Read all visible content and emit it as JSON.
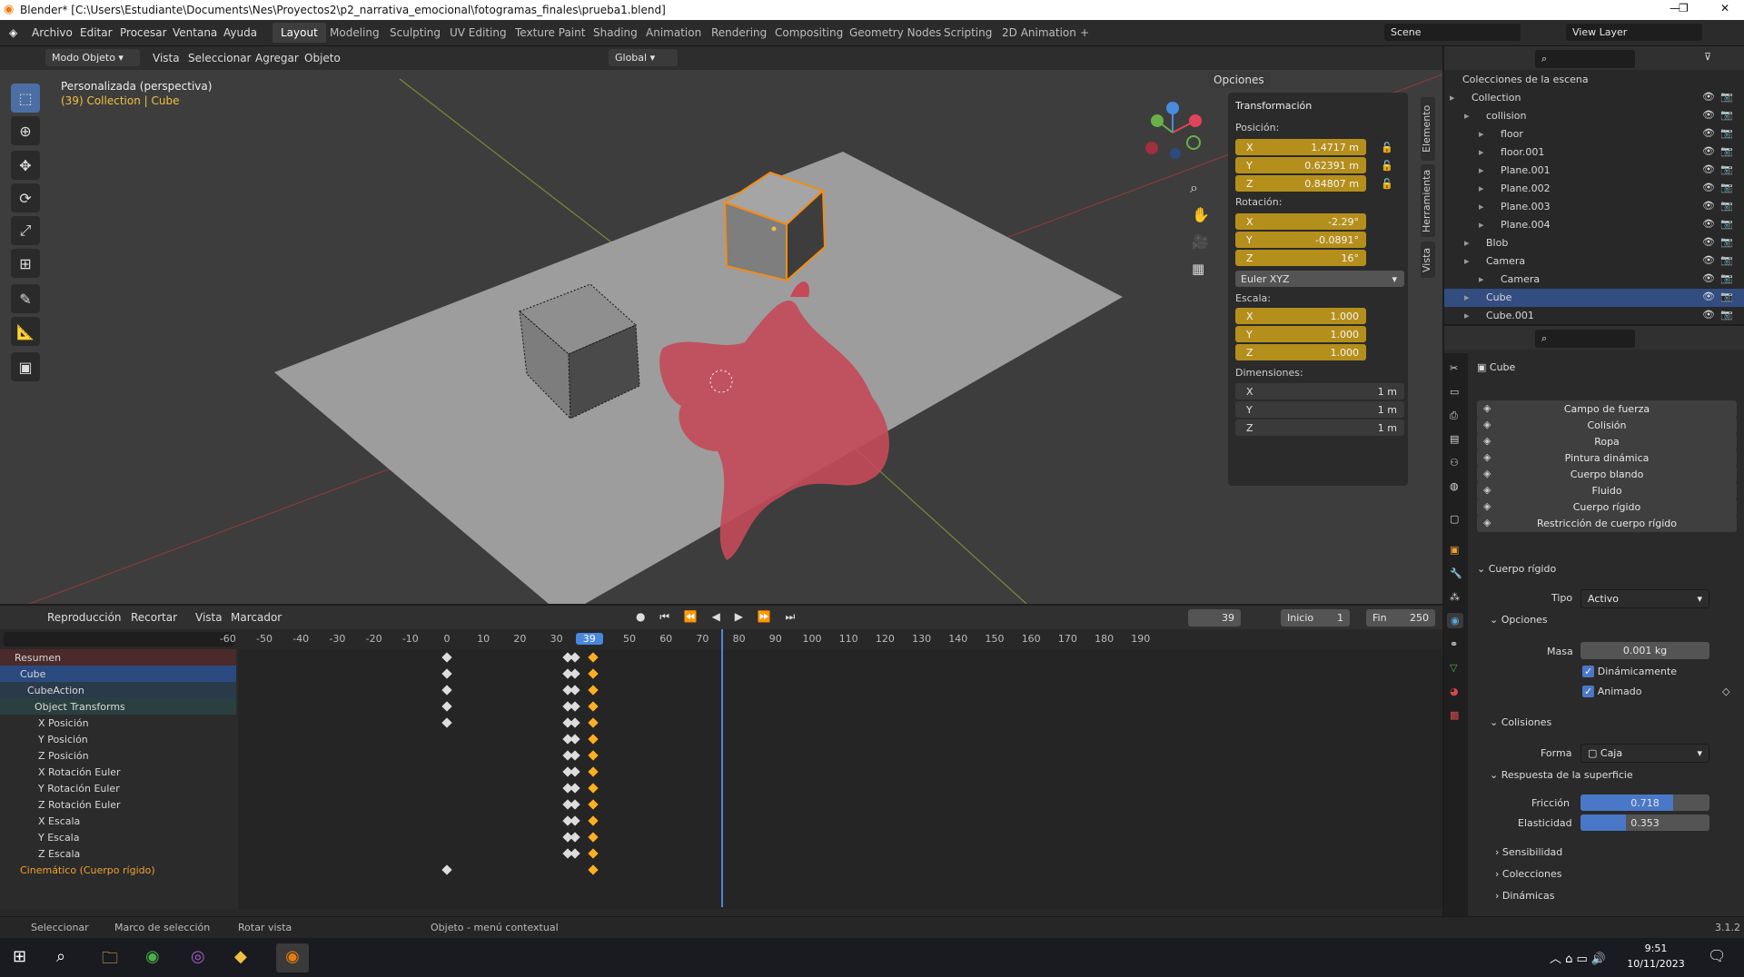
{
  "window": {
    "title": "Blender* [C:\\Users\\Estudiante\\Documents\\Nes\\Proyectos2\\p2_narrativa_emocional\\fotogramas_finales\\prueba1.blend]"
  },
  "menu": [
    "Archivo",
    "Editar",
    "Procesar",
    "Ventana",
    "Ayuda"
  ],
  "workspaces": [
    "Layout",
    "Modeling",
    "Sculpting",
    "UV Editing",
    "Texture Paint",
    "Shading",
    "Animation",
    "Rendering",
    "Compositing",
    "Geometry Nodes",
    "Scripting",
    "2D Animation",
    "+"
  ],
  "scene": "Scene",
  "view_layer": "View Layer",
  "viewport": {
    "mode": "Modo Objeto",
    "menu": [
      "Vista",
      "Seleccionar",
      "Agregar",
      "Objeto"
    ],
    "orientation": "Global",
    "options": "Opciones",
    "view_name": "Personalizada (perspectiva)",
    "collection_info": "(39) Collection | Cube"
  },
  "transform": {
    "header": "Transformación",
    "position_label": "Posición:",
    "position": [
      {
        "axis": "X",
        "value": "1.4717 m"
      },
      {
        "axis": "Y",
        "value": "0.62391 m"
      },
      {
        "axis": "Z",
        "value": "0.84807 m"
      }
    ],
    "rotation_label": "Rotación:",
    "rotation": [
      {
        "axis": "X",
        "value": "-2.29°"
      },
      {
        "axis": "Y",
        "value": "-0.0891°"
      },
      {
        "axis": "Z",
        "value": "16°"
      }
    ],
    "rotation_mode": "Euler XYZ",
    "scale_label": "Escala:",
    "scale": [
      {
        "axis": "X",
        "value": "1.000"
      },
      {
        "axis": "Y",
        "value": "1.000"
      },
      {
        "axis": "Z",
        "value": "1.000"
      }
    ],
    "dimensions_label": "Dimensiones:",
    "dimensions": [
      {
        "axis": "X",
        "value": "1 m"
      },
      {
        "axis": "Y",
        "value": "1 m"
      },
      {
        "axis": "Z",
        "value": "1 m"
      }
    ]
  },
  "side_tabs": [
    "Elemento",
    "Herramienta",
    "Vista"
  ],
  "outliner": {
    "root": "Colecciones de la escena",
    "rows": [
      {
        "name": "Collection",
        "indent": 1,
        "selected": false
      },
      {
        "name": "collision",
        "indent": 2,
        "selected": false
      },
      {
        "name": "floor",
        "indent": 3,
        "selected": false
      },
      {
        "name": "floor.001",
        "indent": 3,
        "selected": false
      },
      {
        "name": "Plane.001",
        "indent": 3,
        "selected": false
      },
      {
        "name": "Plane.002",
        "indent": 3,
        "selected": false
      },
      {
        "name": "Plane.003",
        "indent": 3,
        "selected": false
      },
      {
        "name": "Plane.004",
        "indent": 3,
        "selected": false
      },
      {
        "name": "Blob",
        "indent": 2,
        "selected": false
      },
      {
        "name": "Camera",
        "indent": 2,
        "selected": false
      },
      {
        "name": "Camera",
        "indent": 3,
        "selected": false
      },
      {
        "name": "Cube",
        "indent": 2,
        "selected": true
      },
      {
        "name": "Cube.001",
        "indent": 2,
        "selected": false
      }
    ]
  },
  "properties": {
    "object": "Cube",
    "physics_buttons": [
      "Campo de fuerza",
      "Colisión",
      "Ropa",
      "Pintura dinámica",
      "Cuerpo blando",
      "Fluido",
      "Cuerpo rígido",
      "Restricción de cuerpo rígido"
    ],
    "rigid_body": {
      "title": "Cuerpo rígido",
      "tipo_label": "Tipo",
      "tipo": "Activo",
      "opciones": "Opciones",
      "masa_label": "Masa",
      "masa": "0.001 kg",
      "dinamicamente": "Dinámicamente",
      "animado": "Animado",
      "colisiones": "Colisiones",
      "forma_label": "Forma",
      "forma": "Caja",
      "respuesta": "Respuesta de la superficie",
      "friccion_label": "Fricción",
      "friccion": "0.718",
      "friccion_level": 0.718,
      "elasticidad_label": "Elasticidad",
      "elasticidad": "0.353",
      "elasticidad_level": 0.353,
      "sensibilidad": "Sensibilidad",
      "colecciones": "Colecciones",
      "dinamicas": "Dinámicas"
    }
  },
  "timeline": {
    "menu": [
      "Reproducción",
      "Recortar",
      "Vista",
      "Marcador"
    ],
    "current_frame": "39",
    "start_label": "Inicio",
    "start": "1",
    "end_label": "Fin",
    "end": "250",
    "ticks": [
      "-60",
      "-50",
      "-40",
      "-30",
      "-20",
      "-10",
      "0",
      "10",
      "20",
      "30",
      "39",
      "50",
      "60",
      "70",
      "80",
      "90",
      "100",
      "110",
      "120",
      "130",
      "140",
      "150",
      "160",
      "170",
      "180",
      "190"
    ],
    "channels": [
      "Resumen",
      "Cube",
      "CubeAction",
      "Object Transforms",
      "X Posición",
      "Y Posición",
      "Z Posición",
      "X Rotación Euler",
      "Y Rotación Euler",
      "Z Rotación Euler",
      "X Escala",
      "Y Escala",
      "Z Escala",
      "Cinemático (Cuerpo rígido)"
    ]
  },
  "statusbar": {
    "items": [
      "Seleccionar",
      "Marco de selección",
      "Rotar vista",
      "Objeto - menú contextual"
    ],
    "version": "3.1.2"
  },
  "taskbar": {
    "time": "9:51",
    "date": "10/11/2023"
  }
}
